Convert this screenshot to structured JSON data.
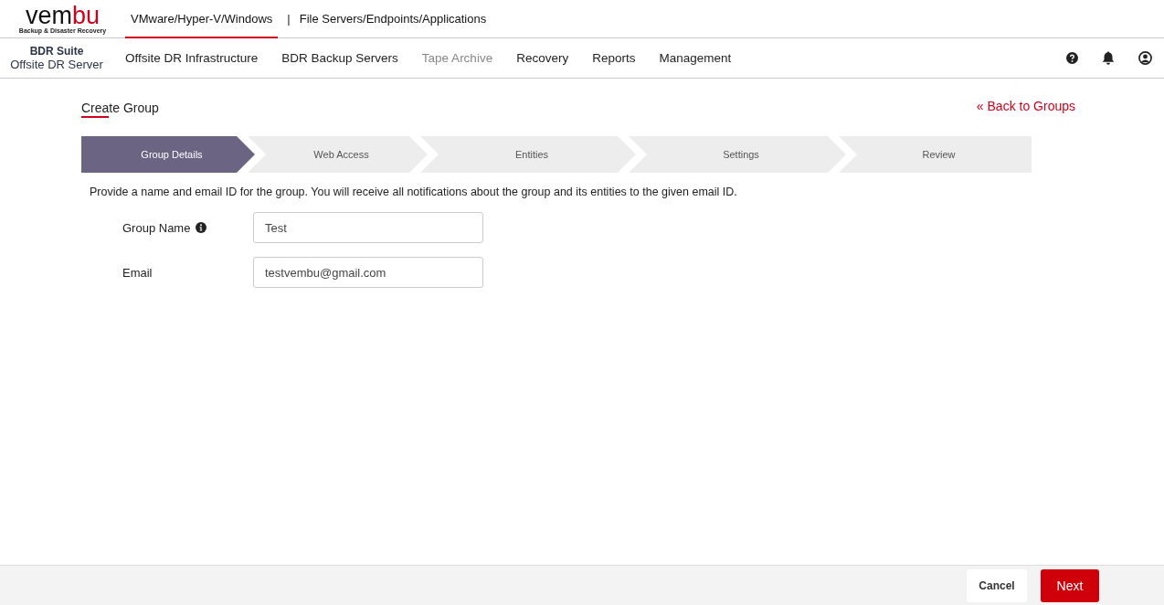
{
  "logo": {
    "wordmark_dark": "vem",
    "wordmark_accent": "bu",
    "tagline": "Backup & Disaster Recovery"
  },
  "product_tabs": [
    {
      "label": "VMware/Hyper-V/Windows",
      "selected": true
    },
    {
      "label": "File Servers/Endpoints/Applications",
      "selected": false
    }
  ],
  "product_separator": "|",
  "suite": {
    "name": "BDR Suite",
    "edition": "Offsite DR Server"
  },
  "nav_items": [
    {
      "label": "Offsite DR Infrastructure",
      "disabled": false
    },
    {
      "label": "BDR Backup Servers",
      "disabled": false
    },
    {
      "label": "Tape Archive",
      "disabled": true
    },
    {
      "label": "Recovery",
      "disabled": false
    },
    {
      "label": "Reports",
      "disabled": false
    },
    {
      "label": "Management",
      "disabled": false
    }
  ],
  "page_title": "Create Group",
  "back_link": "« Back to Groups",
  "steps": [
    {
      "label": "Group Details",
      "selected": true
    },
    {
      "label": "Web Access",
      "selected": false
    },
    {
      "label": "Entities",
      "selected": false
    },
    {
      "label": "Settings",
      "selected": false
    },
    {
      "label": "Review",
      "selected": false
    }
  ],
  "description": "Provide a name and email ID for the group. You will receive all notifications about the group and its entities to the given email ID.",
  "fields": [
    {
      "label": "Group Name",
      "info": true,
      "value": "Test"
    },
    {
      "label": "Email",
      "info": false,
      "value": "testvembu@gmail.com"
    }
  ],
  "buttons": [
    {
      "label": "Cancel",
      "kind": "secondary"
    },
    {
      "label": "Next",
      "kind": "primary"
    }
  ]
}
